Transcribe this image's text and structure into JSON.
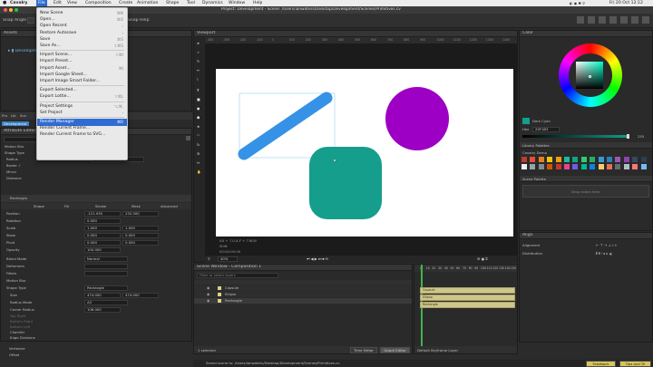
{
  "menubar": {
    "app": "Cavalry",
    "items": [
      "File",
      "Edit",
      "View",
      "Composition",
      "Create",
      "Animation",
      "Shape",
      "Tool",
      "Dynamics",
      "Window",
      "Help"
    ],
    "datetime": "Fri 20 Oct 12:12"
  },
  "titlebar": {
    "title": "Project: Development - Scene: /Users/ianwaters/Desktop/Development/Scenes/Primitives.cv"
  },
  "toolbar": {
    "snap_angle_label": "Snap Angle",
    "snap_help_label": "Snap Help"
  },
  "file_menu": {
    "items": [
      {
        "label": "New Scene",
        "shortcut": "⌘N",
        "sub": false
      },
      {
        "label": "Open...",
        "shortcut": "⌘O",
        "sub": false
      },
      {
        "label": "Open Recent",
        "shortcut": "",
        "sub": true
      },
      {
        "label": "Restore Autosave",
        "shortcut": "",
        "sub": true
      },
      {
        "label": "Save",
        "shortcut": "⌘S",
        "sub": false
      },
      {
        "label": "Save As...",
        "shortcut": "⇧⌘S",
        "sub": false
      },
      {
        "sep": true
      },
      {
        "label": "Import Scene...",
        "shortcut": "⇧⌘I",
        "sub": false
      },
      {
        "label": "Import Preset...",
        "shortcut": "",
        "sub": false
      },
      {
        "label": "Import Asset...",
        "shortcut": "⌘I",
        "sub": false
      },
      {
        "label": "Import Google Sheet...",
        "shortcut": "",
        "sub": false
      },
      {
        "label": "Import Image Smart Folder...",
        "shortcut": "",
        "sub": false
      },
      {
        "sep": true
      },
      {
        "label": "Export Selected...",
        "shortcut": "",
        "sub": false
      },
      {
        "label": "Export Lottie...",
        "shortcut": "⇧⌘L",
        "sub": false
      },
      {
        "sep": true
      },
      {
        "label": "Project Settings",
        "shortcut": "⌥⌘,",
        "sub": false
      },
      {
        "label": "Set Project",
        "shortcut": "",
        "sub": true
      },
      {
        "sep": true
      },
      {
        "label": "Render Manager",
        "shortcut": "⌘R",
        "sub": false,
        "highlight": true
      },
      {
        "label": "Render Current Frame...",
        "shortcut": "",
        "sub": false
      },
      {
        "label": "Render Current Frame to SVG...",
        "shortcut": "",
        "sub": false
      }
    ]
  },
  "assets": {
    "title": "Assets",
    "item": "Development"
  },
  "project_tabs": [
    "Pro",
    "Lib",
    "Sce"
  ],
  "project_item": "Development",
  "attribute_editor": {
    "title": "Attribute Editor",
    "shape_type_label": "Shape Type",
    "motion_blur_label": "Motion Blur",
    "rows": [
      {
        "label": "Radius",
        "value": "257.000"
      },
      {
        "label": "Bezier ✓",
        "value": ""
      },
      {
        "label": "Mirror",
        "value": ""
      },
      {
        "label": "Distance",
        "value": ""
      }
    ],
    "layer_name": "Rectangle",
    "columns": [
      "Shape",
      "Fill",
      "Stroke",
      "Mask",
      "Advanced"
    ],
    "transform_rows": [
      {
        "label": "Position",
        "v1": "-121.935",
        "v2": "232.500"
      },
      {
        "label": "Rotation",
        "v1": "0.000",
        "v2": ""
      },
      {
        "label": "Scale",
        "v1": "1.000",
        "v2": "1.000"
      },
      {
        "label": "Skew",
        "v1": "0.000",
        "v2": "0.000"
      },
      {
        "label": "Pivot",
        "v1": "0.000",
        "v2": "0.000"
      },
      {
        "label": "Opacity",
        "v1": "100.000",
        "v2": ""
      }
    ],
    "blend_mode_label": "Blend Mode",
    "blend_mode_value": "Normal",
    "deformers_label": "Deformers",
    "filters_label": "Filters",
    "motion_blur2_label": "Motion Blur",
    "shape_type2_label": "Shape Type",
    "shape_type2_value": "Rectangle",
    "size_label": "Size",
    "size_v1": "474.000",
    "size_v2": "474.000",
    "radius_mode_label": "Radius Mode",
    "radius_mode_value": "All",
    "corner_radius_label": "Corner Radius",
    "corner_radius_value": "108.000",
    "extra_rows": [
      "Top Right",
      "Bottom Right",
      "Bottom Left",
      "Chamfer",
      "Edge Divisions",
      "Vertexize",
      "Offset"
    ]
  },
  "viewport": {
    "title": "Viewport",
    "zoom": "40%",
    "info_lines": [
      "AX + ⇧U.A.F + ⇧W.W",
      "Shift",
      "00:00:00:00"
    ],
    "ruler_ticks": [
      "-400",
      "-300",
      "-200",
      "-100",
      "0",
      "100",
      "200",
      "300",
      "400",
      "500",
      "600",
      "700",
      "800",
      "900",
      "1000",
      "1100",
      "1200",
      "1300",
      "1400"
    ]
  },
  "shapes": {
    "capsule_color": "#3592e6",
    "circle_color": "#9d00c4",
    "rect_color": "#159e8c"
  },
  "color_panel": {
    "title": "Color",
    "color_name": "Dark Cyan",
    "hex_label": "Hex",
    "hex_value": "29F1B3",
    "alpha": "255",
    "current_color": "#159e8c",
    "library_palettes_label": "Library Palettes",
    "palette_name": "Cavalry Demo",
    "palette_colors": [
      "#c0392b",
      "#e74c3c",
      "#e67e22",
      "#f1c40f",
      "#f39c12",
      "#1abc9c",
      "#16a085",
      "#2ecc71",
      "#27ae60",
      "#3498db",
      "#2980b9",
      "#9b59b6",
      "#8e44ad",
      "#34495e",
      "#2c3e50",
      "#ecf0f1",
      "#95a5a6",
      "#7f8c8d",
      "#d35400",
      "#c0392b",
      "#e84393",
      "#6c5ce7",
      "#00b894",
      "#0984e3",
      "#fdcb6e",
      "#e17055",
      "#636e72",
      "#b2bec3",
      "#ff7675",
      "#74b9ff"
    ],
    "scene_palette_label": "Scene Palette",
    "drop_colors_label": "Drop colors here"
  },
  "align_panel": {
    "title": "Align",
    "alignment_label": "Alignment",
    "distribution_label": "Distribution"
  },
  "scene_window": {
    "title": "Scene Window - Composition 1",
    "search_placeholder": "Filter or select layers",
    "layers": [
      "Capsule",
      "Ellipse",
      "Rectangle"
    ],
    "selected_label": "1 selected",
    "time_editor_label": "Time Editor",
    "graph_editor_label": "Graph Editor"
  },
  "timeline": {
    "ticks": [
      "0",
      "10",
      "20",
      "30",
      "40",
      "50",
      "60",
      "70",
      "80",
      "90",
      "100",
      "110",
      "120",
      "130",
      "140",
      "150"
    ],
    "default_keyframe_label": "Default Keyframe Layer",
    "tracks": [
      "Capsule",
      "Ellipse",
      "Rectangle"
    ]
  },
  "statusbar": {
    "message": "Saved scene to: /Users/ianwaters/Desktop/Development/Scenes/Primitives.cv",
    "feedback_label": "Feedback",
    "tips_label": "Tips and Tri"
  }
}
